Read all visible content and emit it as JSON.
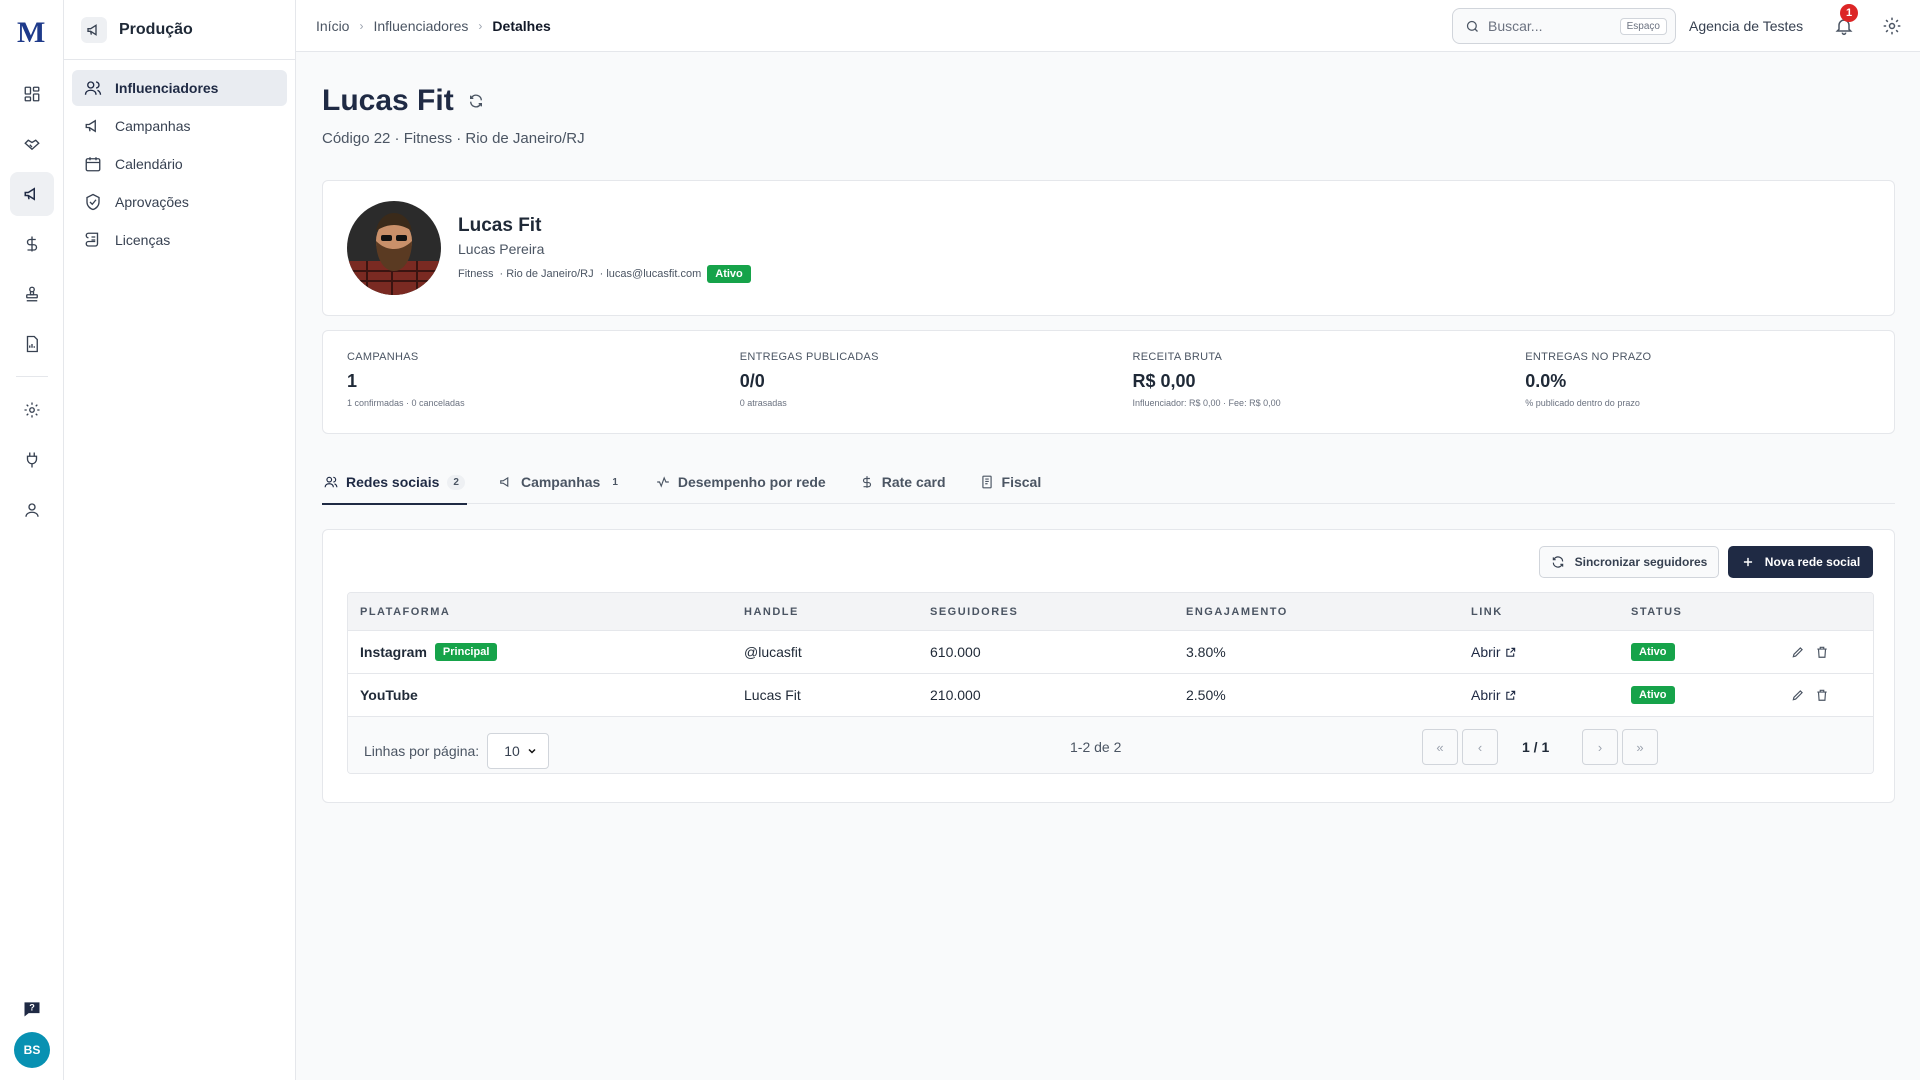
{
  "app": {
    "logo": "M",
    "user_initials": "BS"
  },
  "subnav": {
    "title": "Produção",
    "items": [
      {
        "label": "Influenciadores",
        "icon": "users-icon"
      },
      {
        "label": "Campanhas",
        "icon": "megaphone-icon"
      },
      {
        "label": "Calendário",
        "icon": "calendar-icon"
      },
      {
        "label": "Aprovações",
        "icon": "shield-check-icon"
      },
      {
        "label": "Licenças",
        "icon": "scroll-icon"
      }
    ]
  },
  "topbar": {
    "breadcrumb": [
      "Início",
      "Influenciadores",
      "Detalhes"
    ],
    "search_placeholder": "Buscar...",
    "search_kbd": "Espaço",
    "agency": "Agencia de Testes",
    "notifications": "1"
  },
  "page": {
    "title": "Lucas Fit",
    "subtitle": "Código 22 · Fitness · Rio de Janeiro/RJ"
  },
  "profile": {
    "name": "Lucas Fit",
    "real_name": "Lucas Pereira",
    "category": "Fitness",
    "location": "· Rio de Janeiro/RJ",
    "email": "· lucas@lucasfit.com",
    "status": "Ativo"
  },
  "stats": [
    {
      "label": "CAMPANHAS",
      "value": "1",
      "sub": "1 confirmadas · 0 canceladas"
    },
    {
      "label": "ENTREGAS PUBLICADAS",
      "value": "0/0",
      "sub": "0 atrasadas"
    },
    {
      "label": "RECEITA BRUTA",
      "value": "R$ 0,00",
      "sub": "Influenciador: R$ 0,00 · Fee: R$ 0,00"
    },
    {
      "label": "ENTREGAS NO PRAZO",
      "value": "0.0%",
      "sub": "% publicado dentro do prazo"
    }
  ],
  "tabs": [
    {
      "label": "Redes sociais",
      "count": "2"
    },
    {
      "label": "Campanhas",
      "count": "1"
    },
    {
      "label": "Desempenho por rede"
    },
    {
      "label": "Rate card"
    },
    {
      "label": "Fiscal"
    }
  ],
  "actions": {
    "sync": "Sincronizar seguidores",
    "new": "Nova rede social"
  },
  "table": {
    "headers": [
      "PLATAFORMA",
      "HANDLE",
      "SEGUIDORES",
      "ENGAJAMENTO",
      "LINK",
      "STATUS"
    ],
    "rows": [
      {
        "platform": "Instagram",
        "tag": "Principal",
        "handle": "@lucasfit",
        "followers": "610.000",
        "engagement": "3.80%",
        "link": "Abrir",
        "status": "Ativo"
      },
      {
        "platform": "YouTube",
        "handle": "Lucas Fit",
        "followers": "210.000",
        "engagement": "2.50%",
        "link": "Abrir",
        "status": "Ativo"
      }
    ]
  },
  "pagination": {
    "rows_label": "Linhas por página:",
    "rows_value": "10",
    "range": "1-2 de 2",
    "page": "1 / 1"
  }
}
